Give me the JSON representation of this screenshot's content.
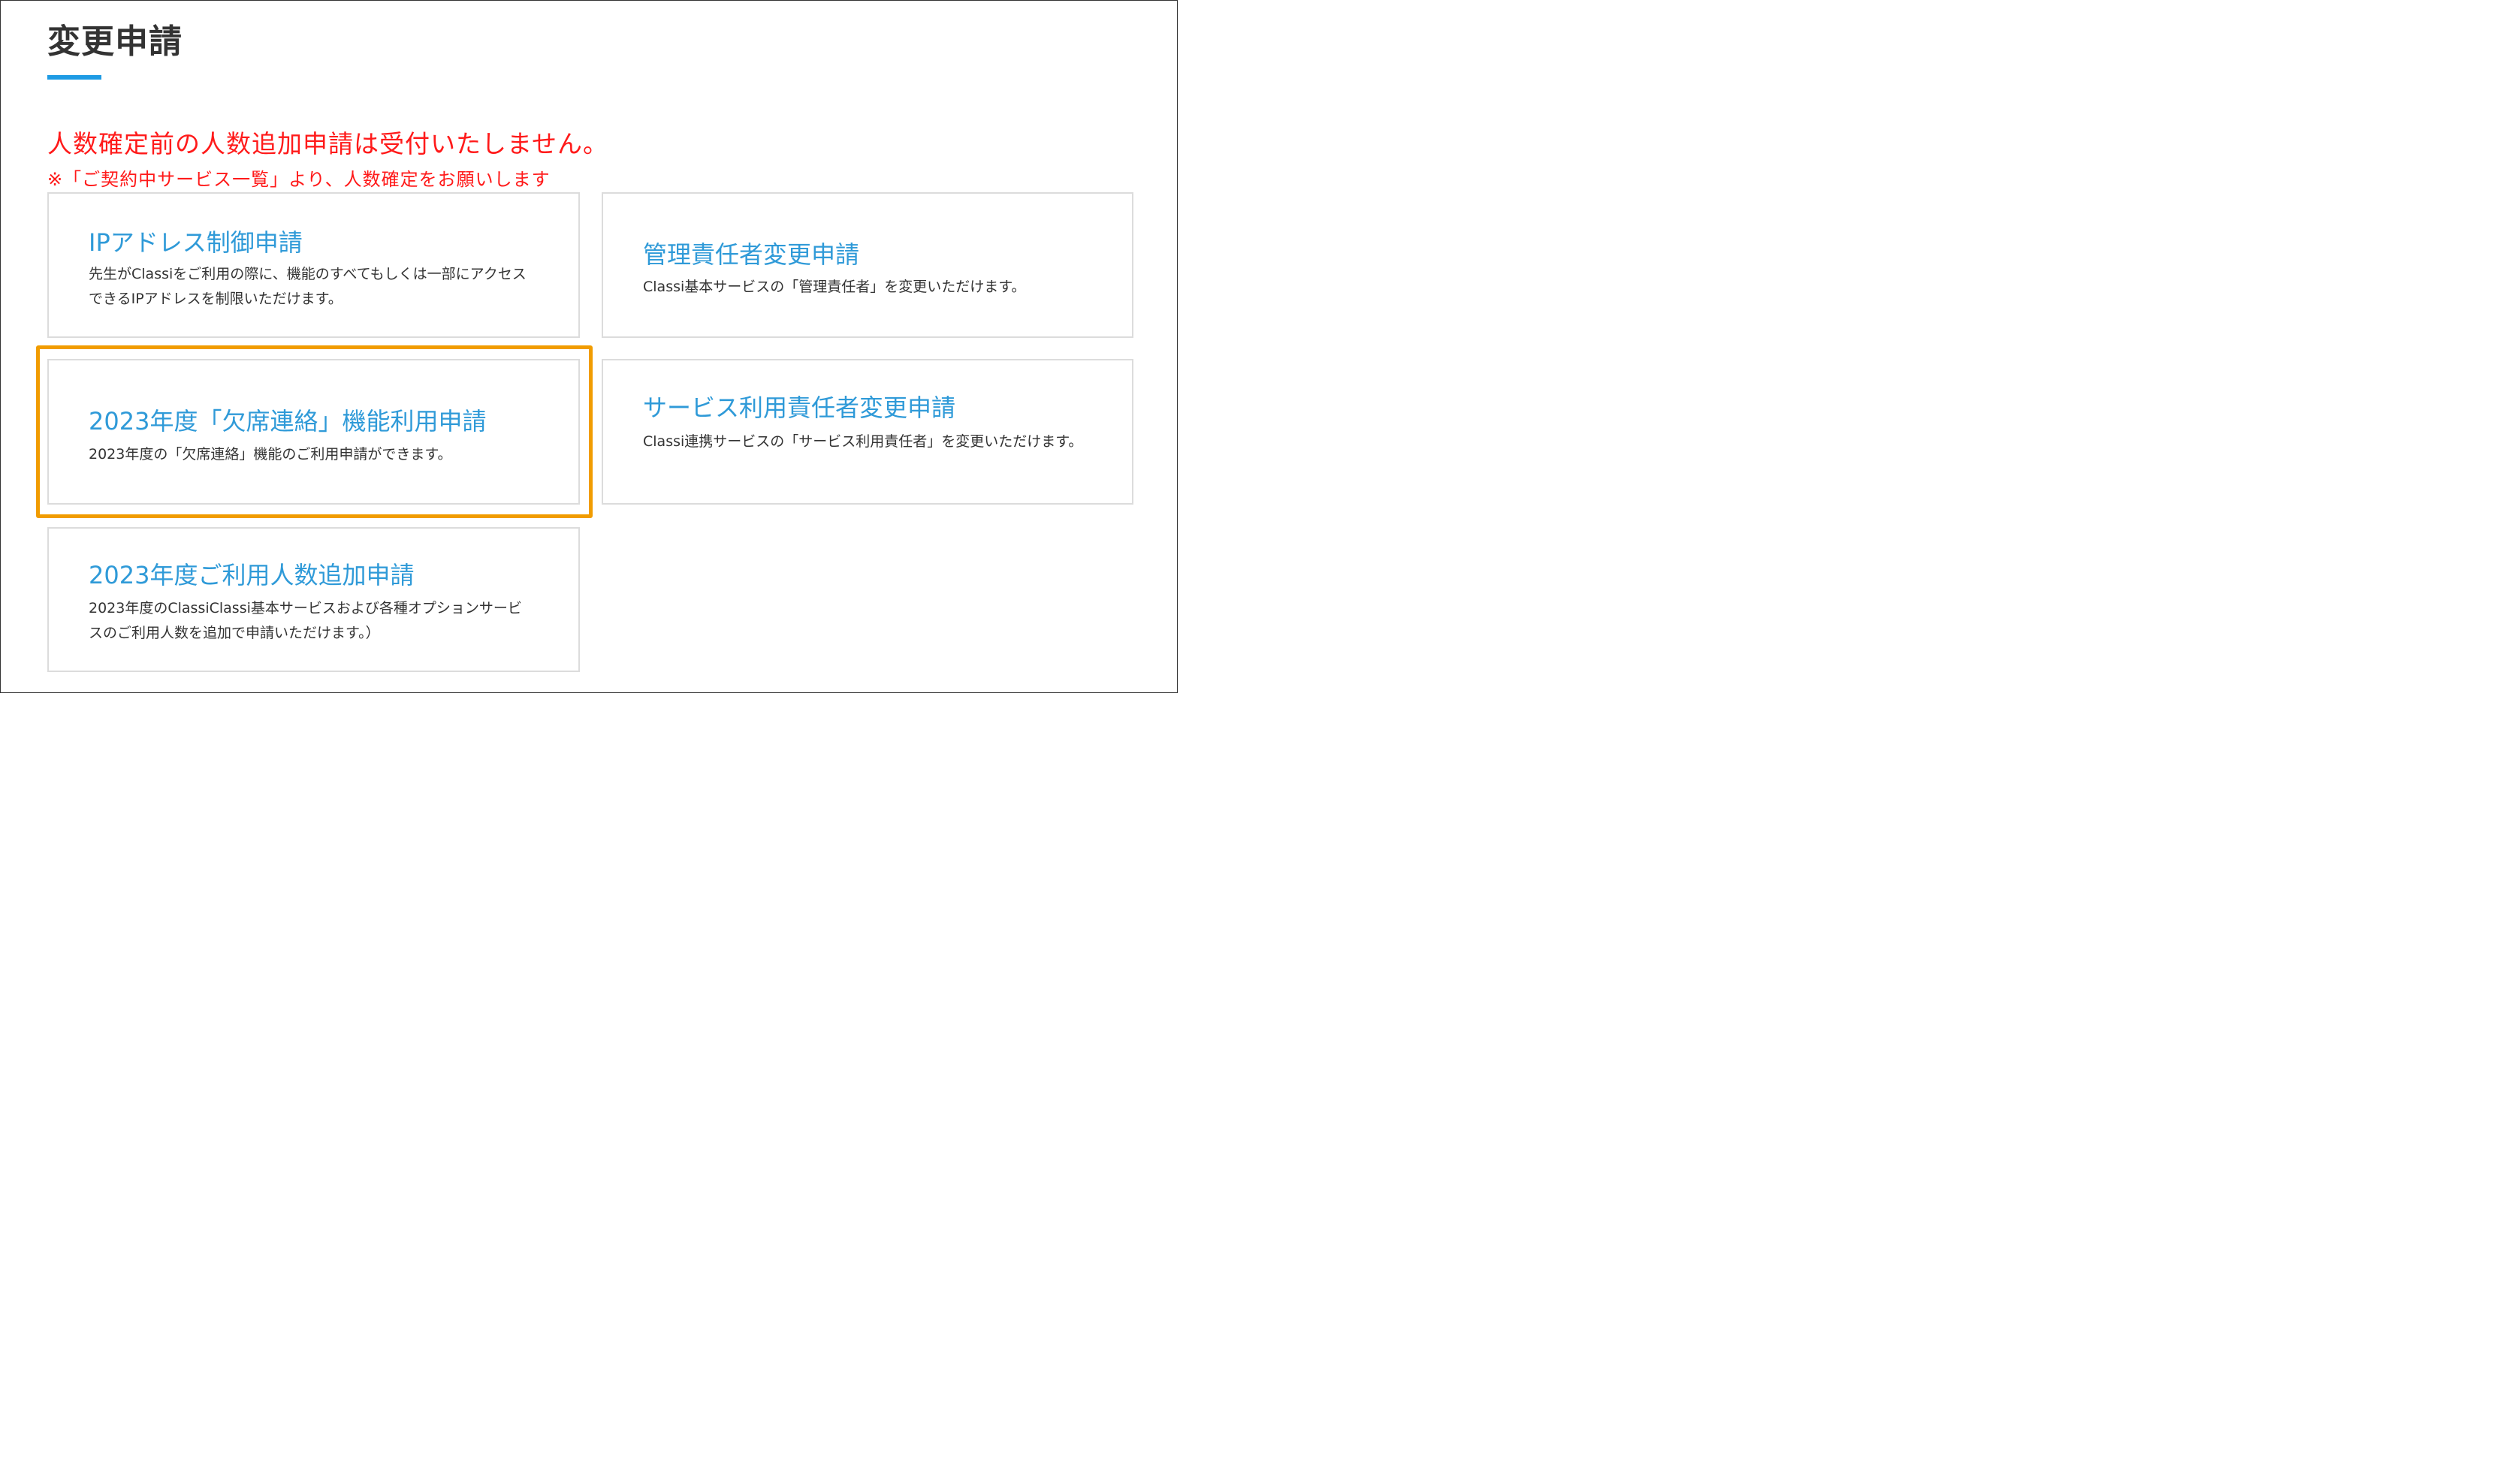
{
  "page": {
    "title": "変更申請",
    "notice_main": "人数確定前の人数追加申請は受付いたしません。",
    "notice_sub": "※「ご契約中サービス一覧」より、人数確定をお願いします"
  },
  "cards": [
    {
      "title": "IPアドレス制御申請",
      "description": "先生がClassiをご利用の際に、機能のすべてもしくは一部にアクセスできるIPアドレスを制限いただけます。"
    },
    {
      "title": "管理責任者変更申請",
      "description": "Classi基本サービスの「管理責任者」を変更いただけます。"
    },
    {
      "title": "2023年度「欠席連絡」機能利用申請",
      "description": "2023年度の「欠席連絡」機能のご利用申請ができます。"
    },
    {
      "title": "サービス利用責任者変更申請",
      "description": "Classi連携サービスの「サービス利用責任者」を変更いただけます。"
    },
    {
      "title": "2023年度ご利用人数追加申請",
      "description": "2023年度のClassiClassi基本サービスおよび各種オプションサービスのご利用人数を追加で申請いただけます。）"
    }
  ],
  "colors": {
    "accent": "#1e9be4",
    "link": "#2f9ad8",
    "warning": "#ff1a1a",
    "highlight": "#f19c00"
  }
}
